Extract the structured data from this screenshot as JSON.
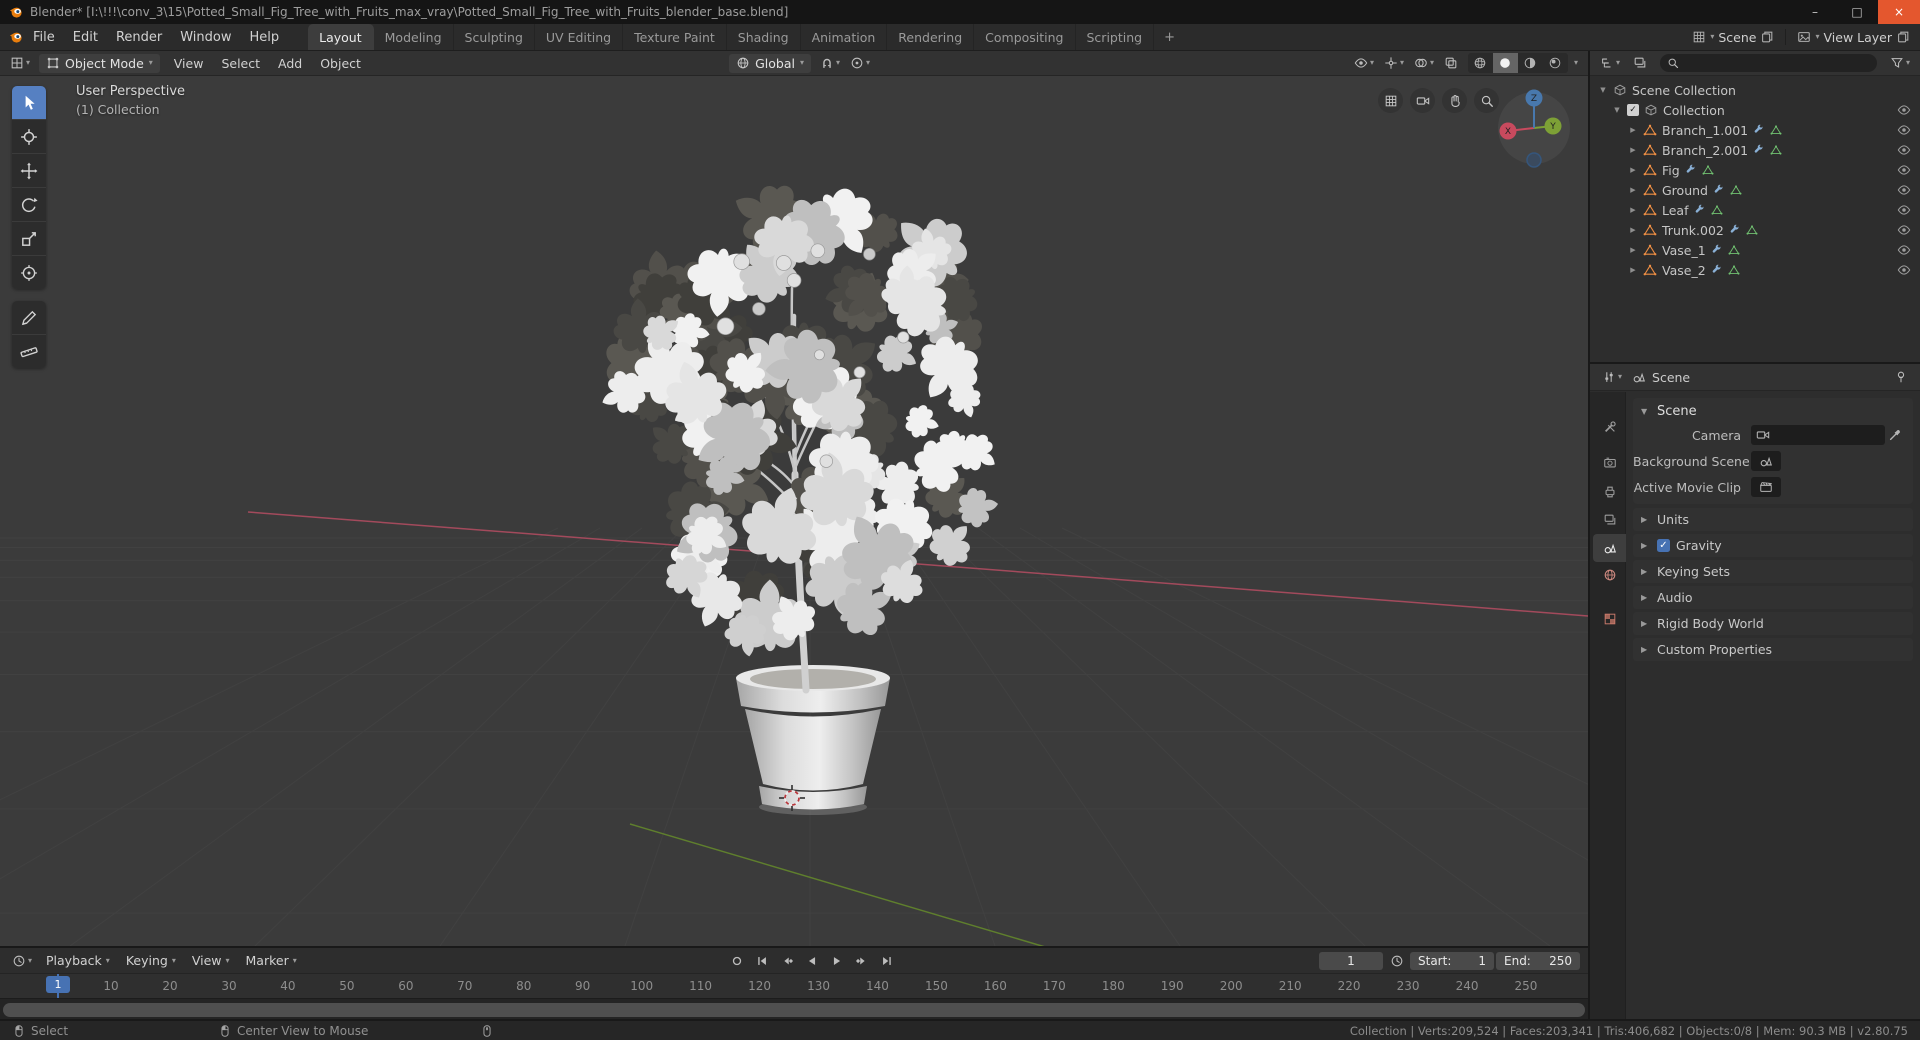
{
  "colors": {
    "accent": "#4772b3",
    "blender_orange": "#e87d0d",
    "tool_active": "#5680c2",
    "close_button": "#e4572e",
    "axis_x": "#c84a5e",
    "axis_y": "#7da036",
    "axis_z": "#4878ad",
    "mesh_icon": "#ef8f44",
    "modifier_icon": "#8ab0d6",
    "data_icon": "#71c171"
  },
  "window": {
    "title": "Blender* [I:\\!!!\\conv_3\\15\\Potted_Small_Fig_Tree_with_Fruits_max_vray\\Potted_Small_Fig_Tree_with_Fruits_blender_base.blend]",
    "controls": {
      "minimize": "–",
      "maximize": "□",
      "close": "×"
    }
  },
  "topbar": {
    "menus": [
      "File",
      "Edit",
      "Render",
      "Window",
      "Help"
    ],
    "workspaces": [
      {
        "label": "Layout",
        "active": true
      },
      {
        "label": "Modeling",
        "active": false
      },
      {
        "label": "Sculpting",
        "active": false
      },
      {
        "label": "UV Editing",
        "active": false
      },
      {
        "label": "Texture Paint",
        "active": false
      },
      {
        "label": "Shading",
        "active": false
      },
      {
        "label": "Animation",
        "active": false
      },
      {
        "label": "Rendering",
        "active": false
      },
      {
        "label": "Compositing",
        "active": false
      },
      {
        "label": "Scripting",
        "active": false
      }
    ],
    "add_workspace": "+",
    "scene": {
      "label": "Scene"
    },
    "view_layer": {
      "label": "View Layer"
    }
  },
  "viewport": {
    "header": {
      "mode": "Object Mode",
      "menus": [
        "View",
        "Select",
        "Add",
        "Object"
      ],
      "orientation": "Global"
    },
    "overlay": {
      "line1": "User Perspective",
      "line2": "(1) Collection"
    },
    "gizmo": {
      "x": "X",
      "y": "Y",
      "z": "Z"
    },
    "tools": [
      "select-box",
      "cursor",
      "move",
      "rotate",
      "scale",
      "transform",
      "annotate",
      "measure"
    ],
    "shading_modes": [
      "wireframe",
      "solid",
      "material-preview",
      "rendered"
    ],
    "active_shading": "solid"
  },
  "outliner": {
    "search_placeholder": "",
    "root_label": "Scene Collection",
    "collection": {
      "name": "Collection",
      "checked": true
    },
    "objects": [
      {
        "name": "Branch_1.001"
      },
      {
        "name": "Branch_2.001"
      },
      {
        "name": "Fig"
      },
      {
        "name": "Ground"
      },
      {
        "name": "Leaf"
      },
      {
        "name": "Trunk.002"
      },
      {
        "name": "Vase_1"
      },
      {
        "name": "Vase_2"
      }
    ]
  },
  "properties": {
    "breadcrumb": "Scene",
    "tabs": [
      "tool",
      "render",
      "output",
      "view-layer",
      "scene",
      "world",
      "texture"
    ],
    "active_tab": "scene",
    "scene_panel": {
      "title": "Scene",
      "camera_label": "Camera",
      "background_label": "Background Scene",
      "clip_label": "Active Movie Clip"
    },
    "panels": [
      {
        "label": "Units",
        "checkbox": false
      },
      {
        "label": "Gravity",
        "checkbox": true
      },
      {
        "label": "Keying Sets",
        "checkbox": false
      },
      {
        "label": "Audio",
        "checkbox": false
      },
      {
        "label": "Rigid Body World",
        "checkbox": false
      },
      {
        "label": "Custom Properties",
        "checkbox": false
      }
    ]
  },
  "timeline": {
    "menus": [
      "Playback",
      "Keying",
      "View",
      "Marker"
    ],
    "current_frame": "1",
    "start_label": "Start:",
    "start_value": "1",
    "end_label": "End:",
    "end_value": "250",
    "ticks": [
      10,
      20,
      30,
      40,
      50,
      60,
      70,
      80,
      90,
      100,
      110,
      120,
      130,
      140,
      150,
      160,
      170,
      180,
      190,
      200,
      210,
      220,
      230,
      240,
      250
    ]
  },
  "statusbar": {
    "items": [
      {
        "label": "Select"
      },
      {
        "label": "Center View to Mouse"
      }
    ],
    "stats": "Collection | Verts:209,524 | Faces:203,341 | Tris:406,682 | Objects:0/8 | Mem: 90.3 MB | v2.80.75"
  }
}
